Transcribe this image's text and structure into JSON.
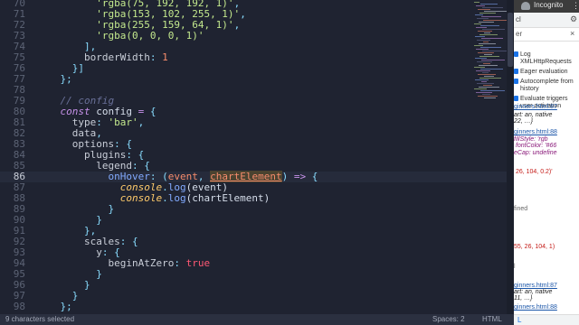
{
  "editor": {
    "active_line": 86,
    "lines": [
      {
        "n": 70,
        "tokens": [
          {
            "t": "          ",
            "c": "plain"
          },
          {
            "t": "'rgba(75, 192, 192, 1)'",
            "c": "string"
          },
          {
            "t": ",",
            "c": "punct"
          }
        ]
      },
      {
        "n": 71,
        "tokens": [
          {
            "t": "          ",
            "c": "plain"
          },
          {
            "t": "'rgba(153, 102, 255, 1)'",
            "c": "string"
          },
          {
            "t": ",",
            "c": "punct"
          }
        ]
      },
      {
        "n": 72,
        "tokens": [
          {
            "t": "          ",
            "c": "plain"
          },
          {
            "t": "'rgba(255, 159, 64, 1)'",
            "c": "string"
          },
          {
            "t": ",",
            "c": "punct"
          }
        ]
      },
      {
        "n": 73,
        "tokens": [
          {
            "t": "          ",
            "c": "plain"
          },
          {
            "t": "'rgba(0, 0, 0, 1)'",
            "c": "string"
          }
        ]
      },
      {
        "n": 74,
        "tokens": [
          {
            "t": "        ",
            "c": "plain"
          },
          {
            "t": "],",
            "c": "punct"
          }
        ]
      },
      {
        "n": 75,
        "tokens": [
          {
            "t": "        ",
            "c": "plain"
          },
          {
            "t": "borderWidth",
            "c": "prop"
          },
          {
            "t": ": ",
            "c": "punct"
          },
          {
            "t": "1",
            "c": "num"
          }
        ]
      },
      {
        "n": 76,
        "tokens": [
          {
            "t": "      ",
            "c": "plain"
          },
          {
            "t": "}]",
            "c": "punct"
          }
        ]
      },
      {
        "n": 77,
        "tokens": [
          {
            "t": "    ",
            "c": "plain"
          },
          {
            "t": "};",
            "c": "punct"
          }
        ]
      },
      {
        "n": 78,
        "tokens": []
      },
      {
        "n": 79,
        "tokens": [
          {
            "t": "    ",
            "c": "plain"
          },
          {
            "t": "// config",
            "c": "comment"
          }
        ]
      },
      {
        "n": 80,
        "tokens": [
          {
            "t": "    ",
            "c": "plain"
          },
          {
            "t": "const",
            "c": "keyword"
          },
          {
            "t": " config ",
            "c": "plain"
          },
          {
            "t": "=",
            "c": "op"
          },
          {
            "t": " {",
            "c": "punct"
          }
        ]
      },
      {
        "n": 81,
        "tokens": [
          {
            "t": "      ",
            "c": "plain"
          },
          {
            "t": "type",
            "c": "prop"
          },
          {
            "t": ": ",
            "c": "punct"
          },
          {
            "t": "'bar'",
            "c": "string"
          },
          {
            "t": ",",
            "c": "punct"
          }
        ]
      },
      {
        "n": 82,
        "tokens": [
          {
            "t": "      ",
            "c": "plain"
          },
          {
            "t": "data",
            "c": "prop"
          },
          {
            "t": ",",
            "c": "punct"
          }
        ]
      },
      {
        "n": 83,
        "tokens": [
          {
            "t": "      ",
            "c": "plain"
          },
          {
            "t": "options",
            "c": "prop"
          },
          {
            "t": ": {",
            "c": "punct"
          }
        ]
      },
      {
        "n": 84,
        "tokens": [
          {
            "t": "        ",
            "c": "plain"
          },
          {
            "t": "plugins",
            "c": "prop"
          },
          {
            "t": ": {",
            "c": "punct"
          }
        ]
      },
      {
        "n": 85,
        "tokens": [
          {
            "t": "          ",
            "c": "plain"
          },
          {
            "t": "legend",
            "c": "prop"
          },
          {
            "t": ": {",
            "c": "punct"
          }
        ]
      },
      {
        "n": 86,
        "tokens": [
          {
            "t": "            ",
            "c": "plain"
          },
          {
            "t": "onHover",
            "c": "func"
          },
          {
            "t": ": (",
            "c": "punct"
          },
          {
            "t": "event",
            "c": "param"
          },
          {
            "t": ", ",
            "c": "punct"
          },
          {
            "t": "chartElement",
            "c": "param-u"
          },
          {
            "t": ") ",
            "c": "punct"
          },
          {
            "t": "=>",
            "c": "op"
          },
          {
            "t": " {",
            "c": "punct"
          }
        ]
      },
      {
        "n": 87,
        "tokens": [
          {
            "t": "              ",
            "c": "plain"
          },
          {
            "t": "console",
            "c": "obj"
          },
          {
            "t": ".",
            "c": "punct"
          },
          {
            "t": "log",
            "c": "func"
          },
          {
            "t": "(event)",
            "c": "plain"
          }
        ]
      },
      {
        "n": 88,
        "tokens": [
          {
            "t": "              ",
            "c": "plain"
          },
          {
            "t": "console",
            "c": "obj"
          },
          {
            "t": ".",
            "c": "punct"
          },
          {
            "t": "log",
            "c": "func"
          },
          {
            "t": "(chartElement)",
            "c": "plain"
          }
        ]
      },
      {
        "n": 89,
        "tokens": [
          {
            "t": "            ",
            "c": "plain"
          },
          {
            "t": "}",
            "c": "punct"
          }
        ]
      },
      {
        "n": 90,
        "tokens": [
          {
            "t": "          ",
            "c": "plain"
          },
          {
            "t": "}",
            "c": "punct"
          }
        ]
      },
      {
        "n": 91,
        "tokens": [
          {
            "t": "        ",
            "c": "plain"
          },
          {
            "t": "},",
            "c": "punct"
          }
        ]
      },
      {
        "n": 92,
        "tokens": [
          {
            "t": "        ",
            "c": "plain"
          },
          {
            "t": "scales",
            "c": "prop"
          },
          {
            "t": ": {",
            "c": "punct"
          }
        ]
      },
      {
        "n": 93,
        "tokens": [
          {
            "t": "          ",
            "c": "plain"
          },
          {
            "t": "y",
            "c": "prop"
          },
          {
            "t": ": {",
            "c": "punct"
          }
        ]
      },
      {
        "n": 94,
        "tokens": [
          {
            "t": "            ",
            "c": "plain"
          },
          {
            "t": "beginAtZero",
            "c": "prop"
          },
          {
            "t": ": ",
            "c": "punct"
          },
          {
            "t": "true",
            "c": "bool"
          }
        ]
      },
      {
        "n": 95,
        "tokens": [
          {
            "t": "          ",
            "c": "plain"
          },
          {
            "t": "}",
            "c": "punct"
          }
        ]
      },
      {
        "n": 96,
        "tokens": [
          {
            "t": "        ",
            "c": "plain"
          },
          {
            "t": "}",
            "c": "punct"
          }
        ]
      },
      {
        "n": 97,
        "tokens": [
          {
            "t": "      ",
            "c": "plain"
          },
          {
            "t": "}",
            "c": "punct"
          }
        ]
      },
      {
        "n": 98,
        "tokens": [
          {
            "t": "    ",
            "c": "plain"
          },
          {
            "t": "};",
            "c": "punct"
          }
        ]
      }
    ]
  },
  "statusbar": {
    "selection": "9 characters selected",
    "spaces": "Spaces: 2",
    "language": "HTML"
  },
  "browser": {
    "incognito_label": "Incognito",
    "menu_icon": "kebab-menu-icon",
    "tab_fragment": "cl",
    "filter_fragment": "er"
  },
  "devtools": {
    "options": [
      {
        "label": "Log XMLHttpRequests",
        "checked": true
      },
      {
        "label": "Eager evaluation",
        "checked": true
      },
      {
        "label": "Autocomplete from history",
        "checked": true
      },
      {
        "label": "Evaluate triggers user activation",
        "checked": true
      }
    ],
    "console_lines": [
      {
        "text": "ginners.html:87",
        "kind": "link"
      },
      {
        "text": "art: an, native",
        "kind": "obj"
      },
      {
        "text": "22, …}",
        "kind": "obj"
      },
      {
        "text": "ginners.html:88",
        "kind": "link"
      },
      {
        "text": "fillStyle: 'rgb",
        "kind": "key"
      },
      {
        "text": " fontColor: '#66",
        "kind": "key"
      },
      {
        "text": "eCap: undefine",
        "kind": "key"
      },
      {
        "text": " 26, 104, 0.2)'",
        "kind": "str"
      },
      {
        "text": "fined",
        "kind": "gray"
      },
      {
        "text": "55, 26, 104, 1)",
        "kind": "str"
      },
      {
        "text": "l",
        "kind": "gray"
      },
      {
        "text": "ginners.html:87",
        "kind": "link"
      },
      {
        "text": "art: an, native",
        "kind": "obj"
      },
      {
        "text": "11, …}",
        "kind": "obj"
      },
      {
        "text": "ginners.html:88",
        "kind": "link"
      },
      {
        "text": "fillStyle: 'rgb",
        "kind": "key"
      },
      {
        "text": " fontColor: '#66",
        "kind": "key"
      },
      {
        "text": "eCap: undefine",
        "kind": "key"
      }
    ],
    "bottom_label": "L"
  }
}
